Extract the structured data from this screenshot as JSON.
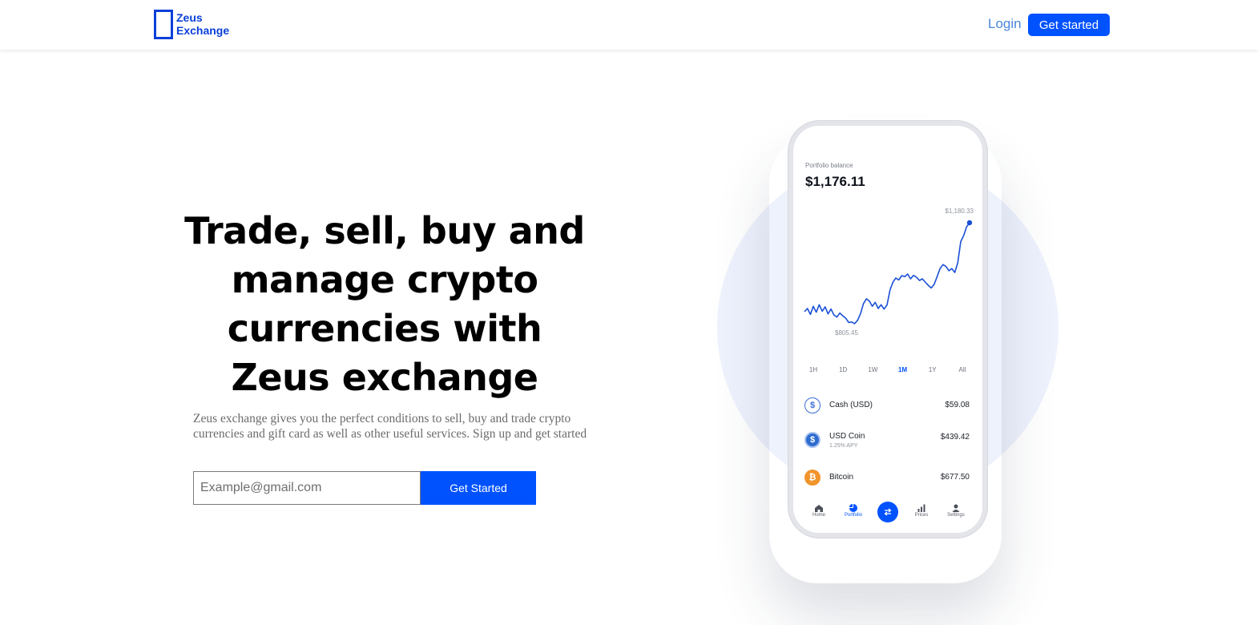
{
  "brand": {
    "line1": "Zeus",
    "line2": "Exchange"
  },
  "nav": {
    "login": "Login",
    "get_started": "Get started"
  },
  "hero": {
    "title": "Trade, sell, buy and manage crypto currencies with Zeus exchange",
    "subtitle": "Zeus exchange gives you the perfect conditions to sell, buy and trade crypto currencies and gift card as well as other useful services. Sign up and get started",
    "email_placeholder": "Example@gmail.com",
    "button": "Get Started"
  },
  "phone": {
    "portfolio_label": "Portfolio balance",
    "balance": "$1,176.11",
    "chart_data": {
      "type": "line",
      "high_label": "$1,180.33",
      "low_label": "$805.45",
      "low": 805.45,
      "high": 1180.33,
      "values": [
        850,
        862,
        840,
        870,
        848,
        876,
        852,
        868,
        842,
        860,
        838,
        830,
        845,
        835,
        826,
        810,
        812,
        805.45,
        818,
        842,
        880,
        898,
        890,
        870,
        885,
        862,
        876,
        860,
        875,
        930,
        960,
        975,
        968,
        984,
        980,
        990,
        972,
        985,
        978,
        966,
        972,
        960,
        948,
        938,
        952,
        980,
        1010,
        1025,
        1018,
        1002,
        1010,
        996,
        1032,
        1110,
        1132,
        1165,
        1180.33
      ]
    },
    "timeframes": [
      "1H",
      "1D",
      "1W",
      "1M",
      "1Y",
      "All"
    ],
    "active_timeframe": "1M",
    "assets": [
      {
        "name": "Cash (USD)",
        "sub": "",
        "value": "$59.08",
        "icon": "dollar-icon",
        "symbol": "$"
      },
      {
        "name": "USD Coin",
        "sub": "1.25% APY",
        "value": "$439.42",
        "icon": "usd-coin-icon",
        "symbol": "$"
      },
      {
        "name": "Bitcoin",
        "sub": "",
        "value": "$677.50",
        "icon": "bitcoin-icon",
        "symbol": "₿"
      }
    ],
    "bottom_nav": [
      "Home",
      "Portfolio",
      "Prices",
      "Settings"
    ],
    "colors": {
      "accent": "#0052ff",
      "line": "#1a4fd6"
    }
  }
}
